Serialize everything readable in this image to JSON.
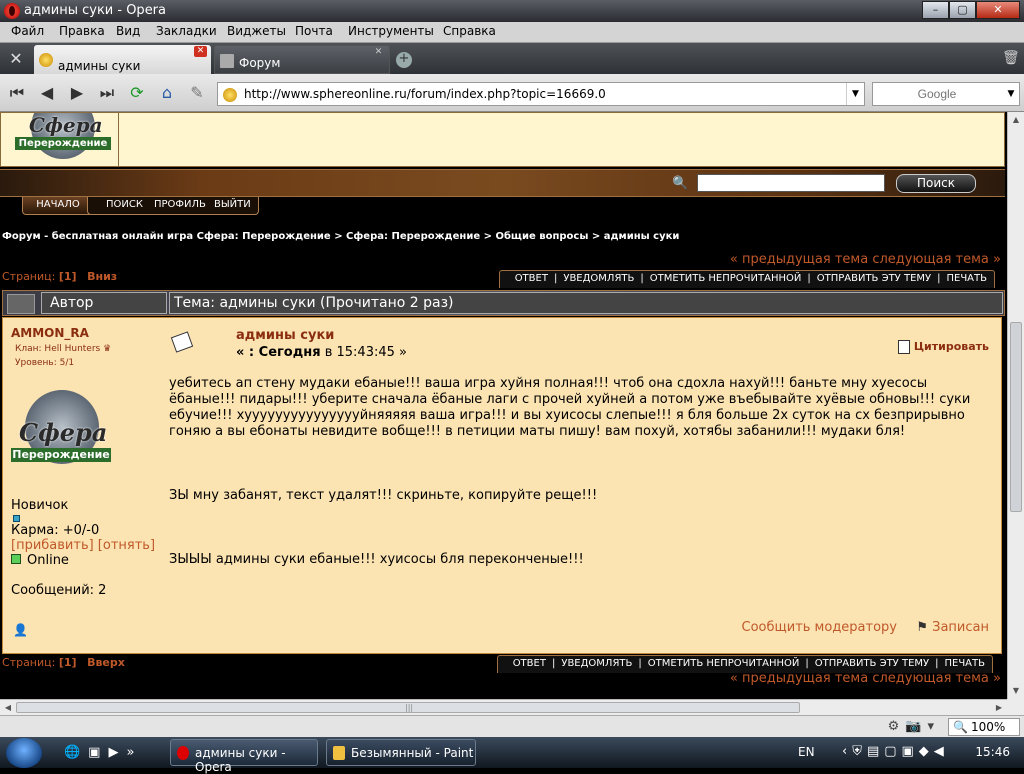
{
  "window": {
    "title": "админы суки - Opera",
    "min": "–",
    "max": "▢",
    "close": "✕"
  },
  "menu": [
    "Файл",
    "Правка",
    "Вид",
    "Закладки",
    "Виджеты",
    "Почта",
    "Инструменты",
    "Справка"
  ],
  "tabs": [
    {
      "label": "админы суки",
      "active": true
    },
    {
      "label": "Форум",
      "active": false
    }
  ],
  "nav": {
    "url": "http://www.sphereonline.ru/forum/index.php?topic=16669.0",
    "search_placeholder": "Google"
  },
  "site": {
    "logo_word": "Сфера",
    "logo_sub": "Перерождение",
    "search_button": "Поиск",
    "nav_start": "НАЧАЛО",
    "nav_items": [
      "ПОИСК",
      "ПРОФИЛЬ",
      "ВЫЙТИ"
    ]
  },
  "breadcrumb": "Форум - бесплатная онлайн игра Сфера: Перерождение > Сфера: Перерождение > Общие вопросы > админы суки",
  "prevnext": "« предыдущая тема следующая тема »",
  "pages_top": {
    "label": "Страниц:",
    "current": "[1]",
    "link": "Вниз"
  },
  "pages_bottom": {
    "label": "Страниц:",
    "current": "[1]",
    "link": "Вверх"
  },
  "actions": [
    "ОТВЕТ",
    "|",
    "УВЕДОМЛЯТЬ",
    "|",
    "ОТМЕТИТЬ НЕПРОЧИТАННОЙ",
    "|",
    "ОТПРАВИТЬ ЭТУ ТЕМУ",
    "|",
    "ПЕЧАТЬ"
  ],
  "thread": {
    "author_header": "Автор",
    "topic_header": "Тема: админы суки  (Прочитано 2 раз)"
  },
  "post": {
    "username": "AMMON_RA",
    "clan": "Клан: Hell Hunters",
    "level": "Уровень: 5/1",
    "rank": "Новичок",
    "karma": "Карма: +0/-0",
    "karma_actions": "[прибавить] [отнять]",
    "status": "Online",
    "messages": "Сообщений: 2",
    "title": "админы суки",
    "date_prefix": "« : Сегодня",
    "date_mid": " в ",
    "date_time": "15:43:45 »",
    "quote": "Цитировать",
    "body": [
      "уебитесь ап стену мудаки ебаные!!! ваша игра хуйня полная!!! чтоб она сдохла нахуй!!! баньте мну хуесосы ёбаные!!! пидары!!! уберите сначала ёбаные лаги с прочей хуйней а потом уже въебывайте хуёвые обновы!!! суки ебучие!!! хуууууууууууууууйняяяяя ваша игра!!! и вы хуисосы слепые!!! я бля больше 2х суток на сх безприрывно гоняю а вы ебонаты невидите вобще!!! в петиции маты пишу! вам похуй, хотябы забанили!!! мудаки бля!",
      "ЗЫ мну забанят, текст удалят!!! скриньте, копируйте реще!!!",
      "ЗЫЫЫ админы суки ебаные!!! хуисосы бля переконченые!!!"
    ],
    "report": "Сообщить модератору",
    "logged": "Записан"
  },
  "status": {
    "zoom": "100%"
  },
  "taskbar": {
    "tasks": [
      "админы суки - Opera",
      "Безымянный - Paint"
    ],
    "lang": "EN",
    "clock": "15:46"
  }
}
